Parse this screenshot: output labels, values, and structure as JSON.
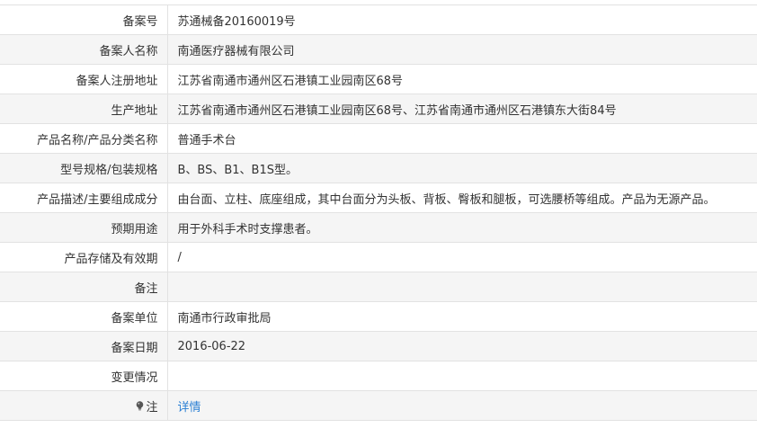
{
  "rows": [
    {
      "label": "备案号",
      "value": "苏通械备20160019号"
    },
    {
      "label": "备案人名称",
      "value": "南通医疗器械有限公司"
    },
    {
      "label": "备案人注册地址",
      "value": "江苏省南通市通州区石港镇工业园南区68号"
    },
    {
      "label": "生产地址",
      "value": "江苏省南通市通州区石港镇工业园南区68号、江苏省南通市通州区石港镇东大街84号"
    },
    {
      "label": "产品名称/产品分类名称",
      "value": "普通手术台"
    },
    {
      "label": "型号规格/包装规格",
      "value": "B、BS、B1、B1S型。"
    },
    {
      "label": "产品描述/主要组成成分",
      "value": "由台面、立柱、底座组成，其中台面分为头板、背板、臀板和腿板，可选腰桥等组成。产品为无源产品。"
    },
    {
      "label": "预期用途",
      "value": "用于外科手术时支撑患者。"
    },
    {
      "label": "产品存储及有效期",
      "value": "/"
    },
    {
      "label": "备注",
      "value": ""
    },
    {
      "label": "备案单位",
      "value": "南通市行政审批局"
    },
    {
      "label": "备案日期",
      "value": "2016-06-22"
    },
    {
      "label": "变更情况",
      "value": ""
    }
  ],
  "note": {
    "label": "注",
    "icon": "lightbulb-icon",
    "link_text": "详情",
    "link_color": "#2a7fd4"
  }
}
